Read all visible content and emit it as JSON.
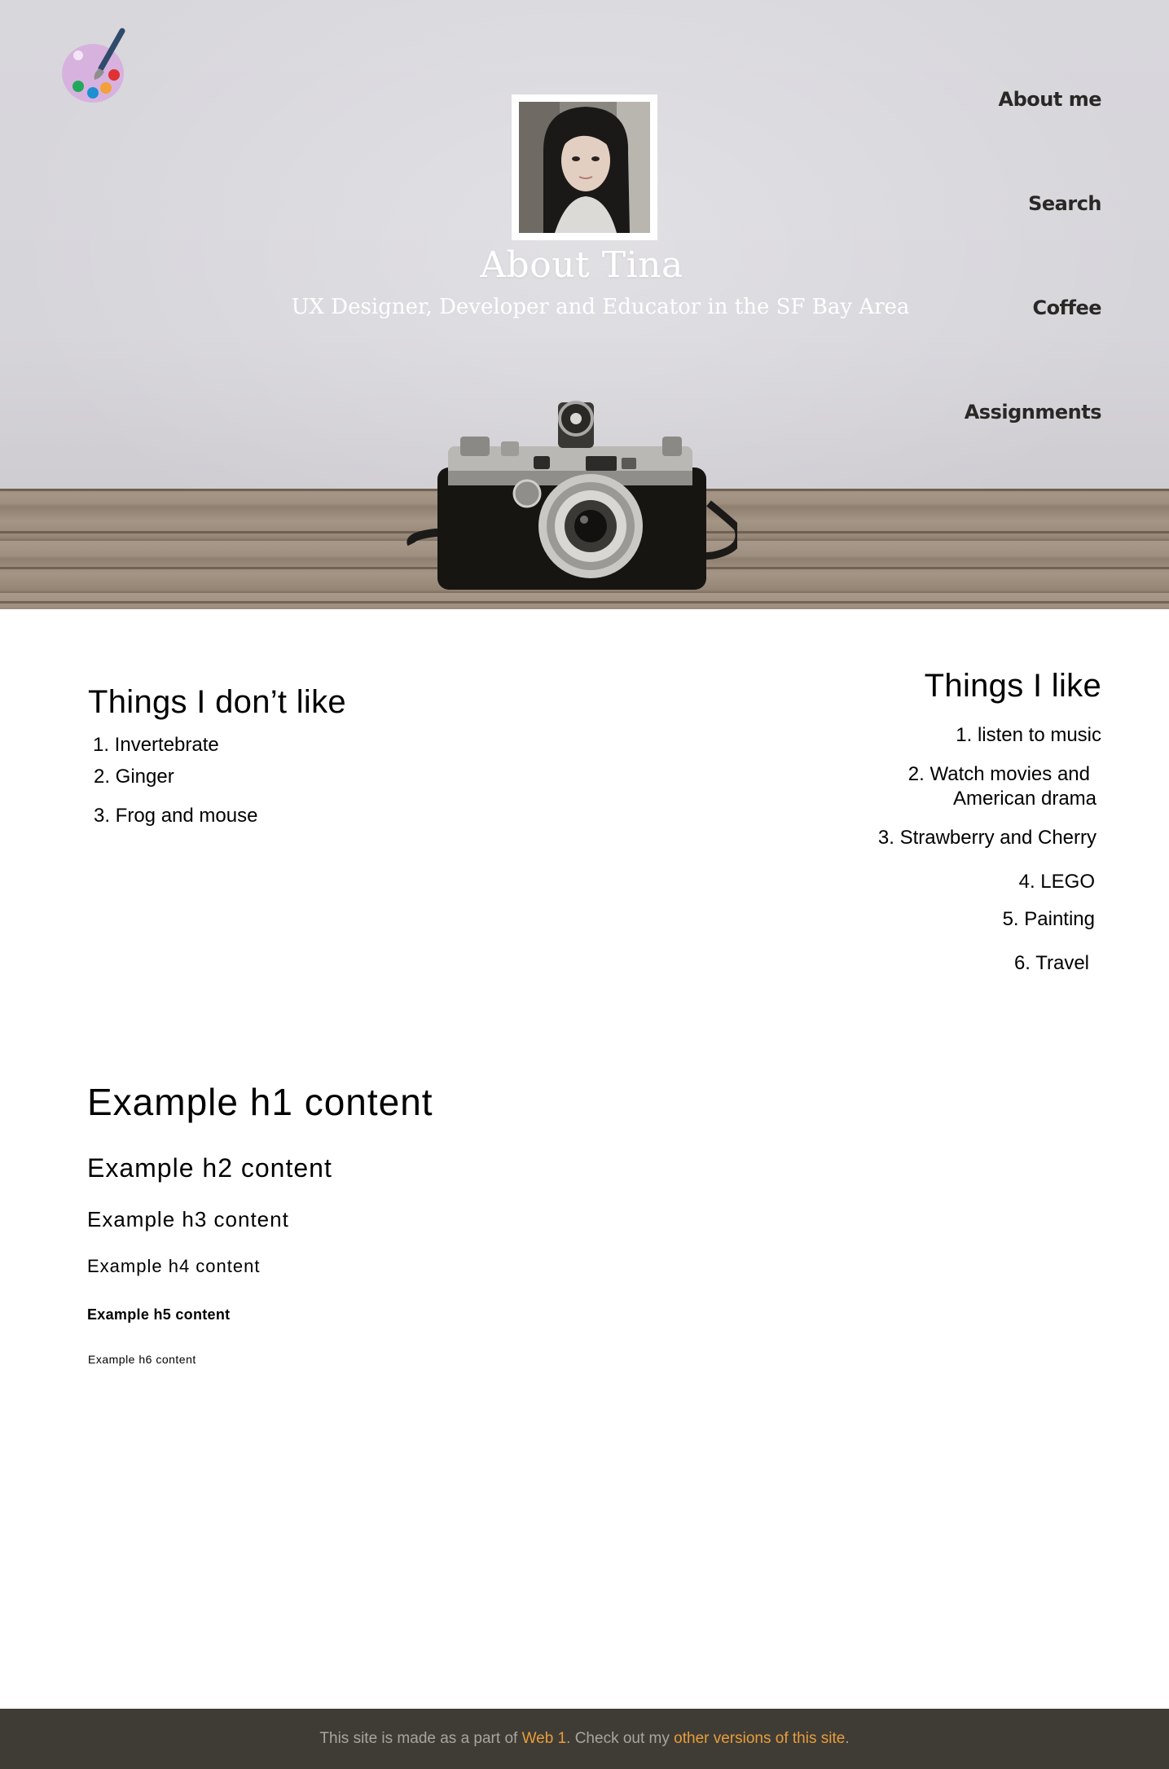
{
  "header": {
    "title": "About Tina",
    "subtitle": "UX Designer, Developer and Educator in the SF Bay Area",
    "logo_icon": "paint-palette-icon",
    "portrait_icon": "profile-photo"
  },
  "nav": {
    "items": [
      {
        "label": "About me"
      },
      {
        "label": "Search"
      },
      {
        "label": "Coffee"
      },
      {
        "label": "Assignments"
      }
    ]
  },
  "dislikes": {
    "heading": "Things I don’t like",
    "items": [
      "1. Invertebrate",
      "2. Ginger",
      "3. Frog and mouse"
    ]
  },
  "likes": {
    "heading": "Things I like",
    "items": [
      "1. listen to music",
      "2. Watch movies and",
      "American drama",
      "3. Strawberry and Cherry",
      "4. LEGO",
      "5. Painting",
      "6. Travel"
    ]
  },
  "examples": {
    "h1": "Example h1 content",
    "h2": "Example h2 content",
    "h3": "Example h3 content",
    "h4": "Example h4 content",
    "h5": "Example h5 content",
    "h6": "Example h6 content"
  },
  "footer": {
    "text_before": "This site is made as a part of ",
    "link1": "Web 1",
    "text_middle": ". Check out my ",
    "link2": "other versions of this site",
    "text_after": ".",
    "background": "#3f3c36",
    "link_color": "#e89d3a"
  }
}
